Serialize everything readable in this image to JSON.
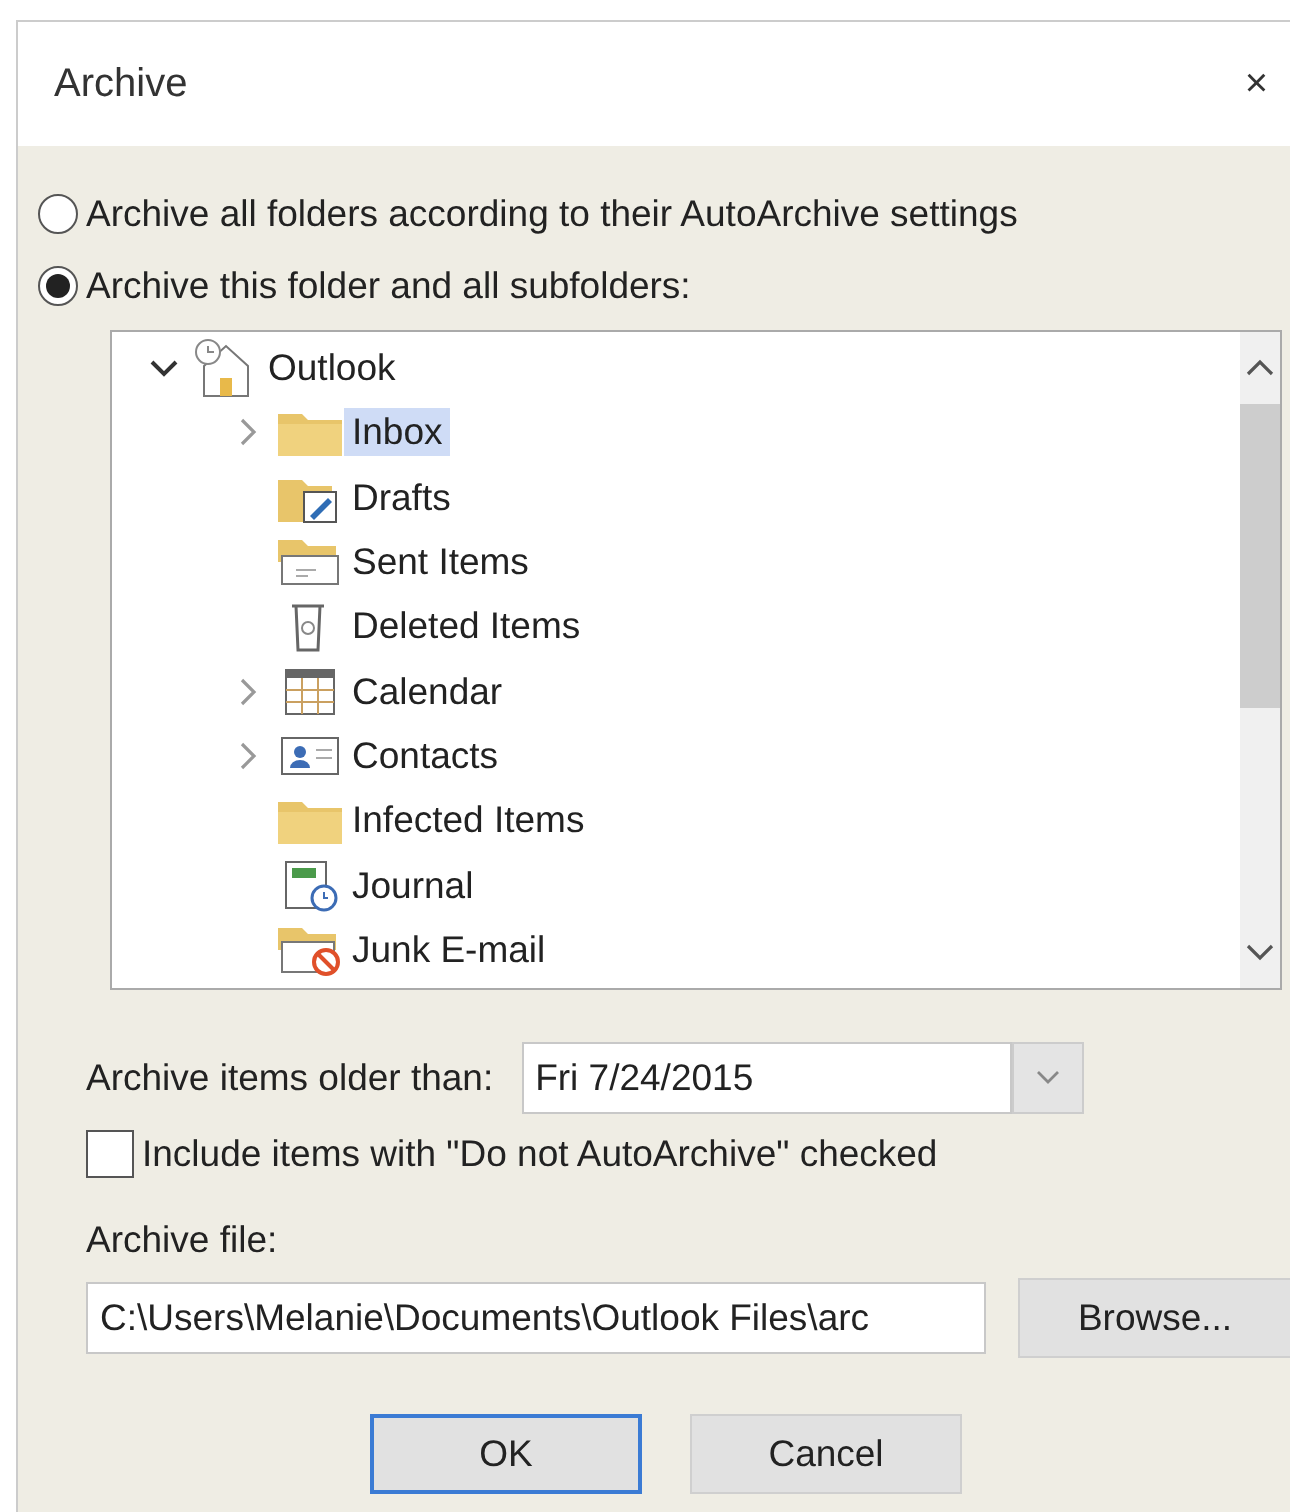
{
  "window": {
    "title": "Archive",
    "close": "×"
  },
  "scope_options": [
    {
      "label": "Archive all folders according to their AutoArchive settings",
      "selected": false
    },
    {
      "label": "Archive this folder and all subfolders:",
      "selected": true
    }
  ],
  "folder_tree": {
    "root": {
      "label": "Outlook",
      "expanded": true,
      "children": [
        {
          "label": "Inbox",
          "kind": "folder",
          "expandable": true,
          "selected": true
        },
        {
          "label": "Drafts",
          "kind": "drafts",
          "expandable": false,
          "selected": false
        },
        {
          "label": "Sent Items",
          "kind": "sent",
          "expandable": false,
          "selected": false
        },
        {
          "label": "Deleted Items",
          "kind": "trash",
          "expandable": false,
          "selected": false
        },
        {
          "label": "Calendar",
          "kind": "calendar",
          "expandable": true,
          "selected": false
        },
        {
          "label": "Contacts",
          "kind": "contacts",
          "expandable": true,
          "selected": false
        },
        {
          "label": "Infected Items",
          "kind": "folder",
          "expandable": false,
          "selected": false
        },
        {
          "label": "Journal",
          "kind": "journal",
          "expandable": false,
          "selected": false
        },
        {
          "label": "Junk E-mail",
          "kind": "junk",
          "expandable": false,
          "selected": false
        }
      ]
    }
  },
  "older_than": {
    "label": "Archive items older than:",
    "value": "Fri 7/24/2015"
  },
  "include_option": {
    "label": "Include items with \"Do not AutoArchive\" checked",
    "checked": false
  },
  "archive_file": {
    "label": "Archive file:",
    "value": "C:\\Users\\Melanie\\Documents\\Outlook Files\\arc"
  },
  "buttons": [
    {
      "label": "Browse...",
      "kind": "browse"
    },
    {
      "label": "OK",
      "kind": "default"
    },
    {
      "label": "Cancel",
      "kind": "normal"
    }
  ]
}
